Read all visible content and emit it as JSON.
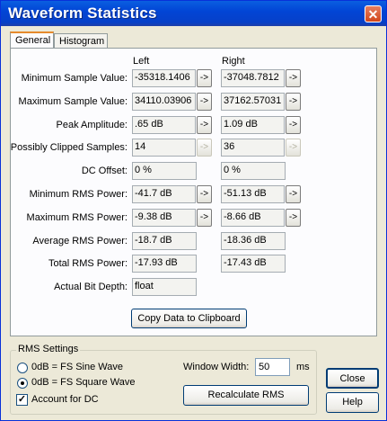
{
  "window": {
    "title": "Waveform Statistics",
    "close_glyph": "✕"
  },
  "tabs": [
    {
      "label": "General"
    },
    {
      "label": "Histogram"
    }
  ],
  "columns": {
    "left": "Left",
    "right": "Right"
  },
  "rows": [
    {
      "label": "Minimum Sample Value:",
      "left": "-35318.1406",
      "right": "-37048.7812",
      "arrow": "->",
      "arrow_enabled": true
    },
    {
      "label": "Maximum Sample Value:",
      "left": "34110.03906",
      "right": "37162.57031",
      "arrow": "->",
      "arrow_enabled": true
    },
    {
      "label": "Peak Amplitude:",
      "left": ".65 dB",
      "right": "1.09 dB",
      "arrow": "->",
      "arrow_enabled": true
    },
    {
      "label": "Possibly Clipped Samples:",
      "left": "14",
      "right": "36",
      "arrow": "->",
      "arrow_enabled": false
    },
    {
      "label": "DC Offset:",
      "left": "0 %",
      "right": "0 %"
    },
    {
      "label": "Minimum RMS Power:",
      "left": "-41.7 dB",
      "right": "-51.13 dB",
      "arrow": "->",
      "arrow_enabled": true
    },
    {
      "label": "Maximum RMS Power:",
      "left": "-9.38 dB",
      "right": "-8.66 dB",
      "arrow": "->",
      "arrow_enabled": true
    },
    {
      "label": "Average RMS Power:",
      "left": "-18.7 dB",
      "right": "-18.36 dB"
    },
    {
      "label": "Total RMS Power:",
      "left": "-17.93 dB",
      "right": "-17.43 dB"
    },
    {
      "label": "Actual Bit Depth:",
      "left": "float"
    }
  ],
  "copy_button": "Copy Data to Clipboard",
  "rms_settings": {
    "title": "RMS Settings",
    "sine_label": "0dB = FS Sine Wave",
    "square_label": "0dB = FS Square Wave",
    "selected": "square",
    "account_dc_label": "Account for DC",
    "account_dc_checked": true,
    "window_width_label": "Window Width:",
    "window_width_value": "50",
    "window_width_unit": "ms",
    "recalculate_label": "Recalculate RMS"
  },
  "buttons": {
    "close": "Close",
    "help": "Help"
  }
}
